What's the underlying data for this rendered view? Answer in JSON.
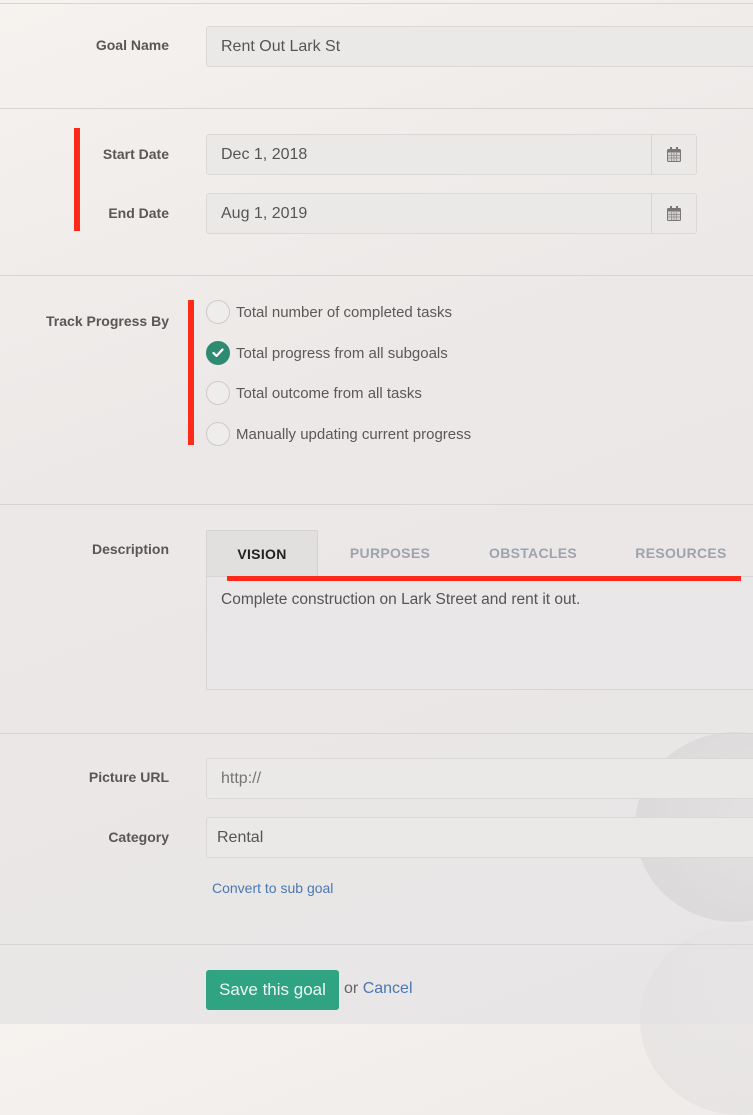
{
  "goal_name": {
    "label": "Goal Name",
    "value": "Rent Out Lark St"
  },
  "dates": {
    "start": {
      "label": "Start Date",
      "value": "Dec 1, 2018",
      "icon": "calendar-icon"
    },
    "end": {
      "label": "End Date",
      "value": "Aug 1, 2019",
      "icon": "calendar-icon"
    }
  },
  "track_progress": {
    "label": "Track Progress By",
    "options": [
      {
        "label": "Total number of completed tasks",
        "checked": false
      },
      {
        "label": "Total progress from all subgoals",
        "checked": true
      },
      {
        "label": "Total outcome from all tasks",
        "checked": false
      },
      {
        "label": "Manually updating current progress",
        "checked": false
      }
    ]
  },
  "description": {
    "label": "Description",
    "tabs": [
      {
        "label": "VISION",
        "active": true
      },
      {
        "label": "PURPOSES",
        "active": false
      },
      {
        "label": "OBSTACLES",
        "active": false
      },
      {
        "label": "RESOURCES",
        "active": false
      }
    ],
    "text": "Complete construction on Lark Street and rent it out."
  },
  "picture_url": {
    "label": "Picture URL",
    "placeholder": "http://"
  },
  "category": {
    "label": "Category",
    "value": "Rental"
  },
  "convert_link": "Convert to sub goal",
  "actions": {
    "save": "Save this goal",
    "or": "or",
    "cancel": "Cancel"
  },
  "colors": {
    "accent": "#2fa382",
    "check": "#2e8a70",
    "annotation": "#ff2a1a",
    "link": "#4a78b0"
  }
}
